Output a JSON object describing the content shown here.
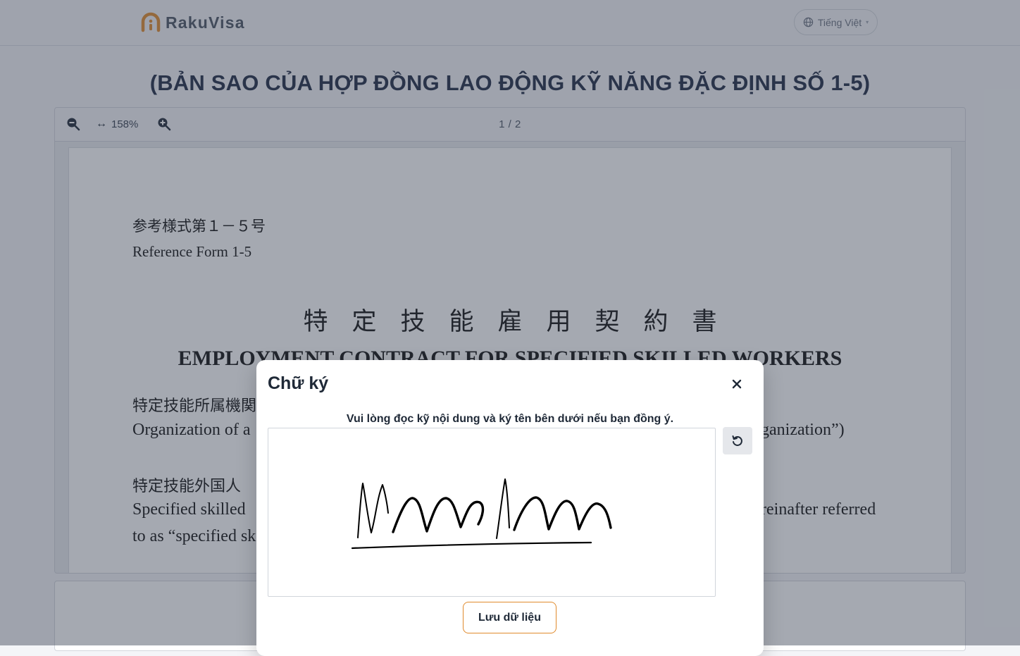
{
  "header": {
    "brand": "RakuVisa",
    "language": "Tiếng Việt",
    "brand_color": "#e08a2c"
  },
  "page": {
    "title": "(BẢN SAO CỦA HỢP ĐỒNG LAO ĐỘNG KỸ NĂNG ĐẶC ĐỊNH SỐ 1-5)"
  },
  "viewer": {
    "zoom_label": "158%",
    "page_indicator": "1 / 2",
    "document": {
      "ref_jp": "参考様式第１－５号",
      "ref_en": "Reference Form 1-5",
      "title_jp": "特定技能雇用契約書",
      "title_en": "EMPLOYMENT CONTRACT FOR SPECIFIED SKILLED WORKERS",
      "p1_jp": "特定技能所属機関",
      "p1_en": "Organization of a",
      "p1_en_tail": "ganization”)",
      "p2_jp": "特定技能外国人",
      "p2_en": "Specified skilled",
      "p2_en_tail": "reinafter referred",
      "p3_en": "to as “specified sk"
    }
  },
  "modal": {
    "title": "Chữ ký",
    "instruction": "Vui lòng đọc kỹ nội dung và ký tên bên dưới nếu bạn đồng ý.",
    "save_label": "Lưu dữ liệu",
    "accent_color": "#e08a2c"
  }
}
